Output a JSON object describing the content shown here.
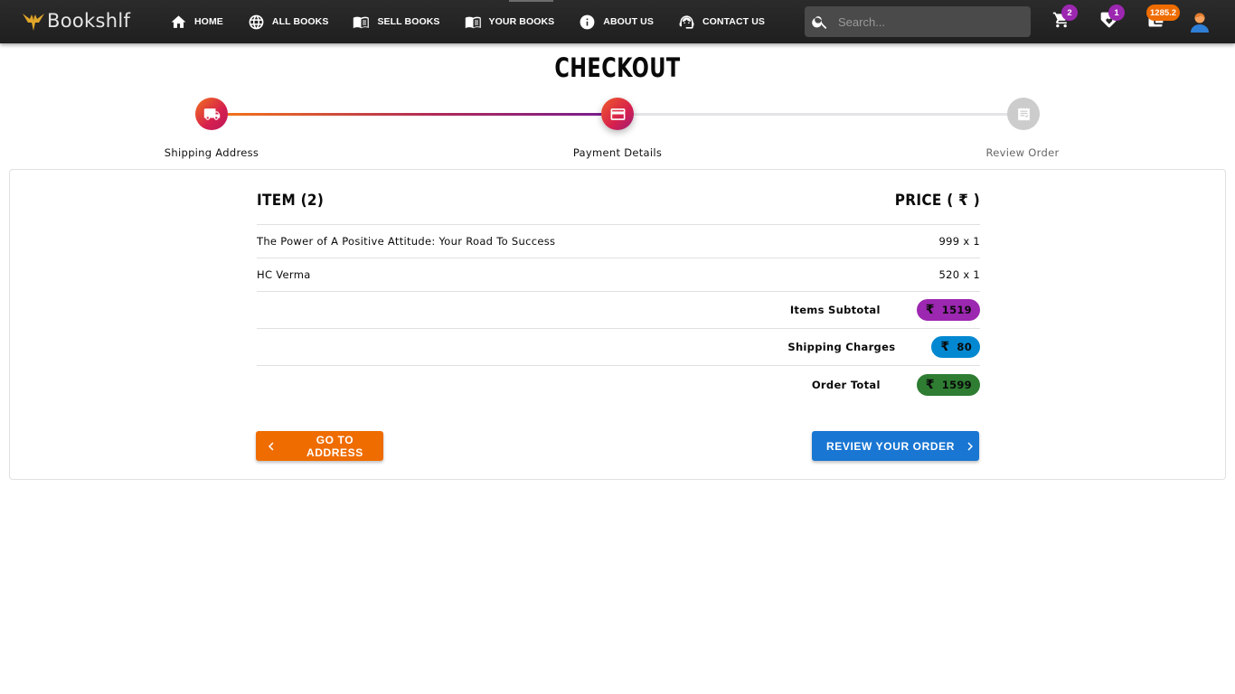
{
  "navbar": {
    "brand": "Bookshlf",
    "links": [
      {
        "label": "HOME",
        "icon": "home-icon"
      },
      {
        "label": "ALL BOOKS",
        "icon": "globe-icon"
      },
      {
        "label": "SELL BOOKS",
        "icon": "book-open-icon"
      },
      {
        "label": "YOUR BOOKS",
        "icon": "book-open-icon"
      },
      {
        "label": "ABOUT US",
        "icon": "info-icon"
      },
      {
        "label": "CONTACT US",
        "icon": "support-agent-icon"
      }
    ],
    "search_placeholder": "Search...",
    "cart_count": "2",
    "wishlist_count": "1",
    "wallet_balance": "1285.2",
    "badge_colors": {
      "cart": "#9c27b0",
      "wishlist": "#9c27b0",
      "wallet": "#ef6c00"
    }
  },
  "checkout": {
    "title": "CHECKOUT",
    "steps": [
      {
        "label": "Shipping Address",
        "status": "completed",
        "icon": "truck-icon"
      },
      {
        "label": "Payment Details",
        "status": "active",
        "icon": "credit-card-icon"
      },
      {
        "label": "Review Order",
        "status": "pending",
        "icon": "receipt-icon"
      }
    ]
  },
  "summary": {
    "item_header": "ITEM (2)",
    "price_header": "PRICE ( ₹ )",
    "items": [
      {
        "title": "The Power of A Positive Attitude: Your Road To Success",
        "price": "999 x 1"
      },
      {
        "title": "HC Verma",
        "price": "520 x 1"
      }
    ],
    "currency_symbol": "₹",
    "subtotal": {
      "label": "Items Subtotal",
      "value": "1519",
      "color": "#9c27b0"
    },
    "shipping": {
      "label": "Shipping Charges",
      "value": "80",
      "color": "#0288d1"
    },
    "total": {
      "label": "Order Total",
      "value": "1599",
      "color": "#2e7d32"
    }
  },
  "actions": {
    "back_label": "GO TO ADDRESS",
    "next_label": "REVIEW YOUR ORDER"
  }
}
